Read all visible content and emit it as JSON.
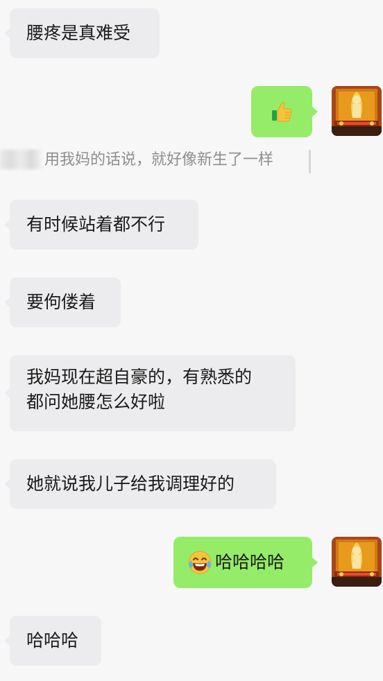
{
  "messages": [
    {
      "side": "in",
      "text": "腰疼是真难受"
    },
    {
      "side": "out",
      "emoji": "thumbs-up-icon"
    },
    {
      "quote": "用我妈的话说，就好像新生了一样"
    },
    {
      "side": "in",
      "text": "有时候站着都不行"
    },
    {
      "side": "in",
      "text": "要佝偻着"
    },
    {
      "side": "in",
      "lines": [
        "我妈现在超自豪的，有熟悉的",
        "都问她腰怎么好啦"
      ]
    },
    {
      "side": "in",
      "text": "她就说我儿子给我调理好的"
    },
    {
      "side": "out",
      "emoji": "laughing-tears-icon",
      "text": "哈哈哈哈"
    },
    {
      "side": "in",
      "text": "哈哈哈"
    }
  ],
  "colors": {
    "incoming_bubble": "#ececee",
    "outgoing_bubble": "#95ec69",
    "background": "#f7f7f7",
    "quote_text": "#8e8e8e"
  }
}
